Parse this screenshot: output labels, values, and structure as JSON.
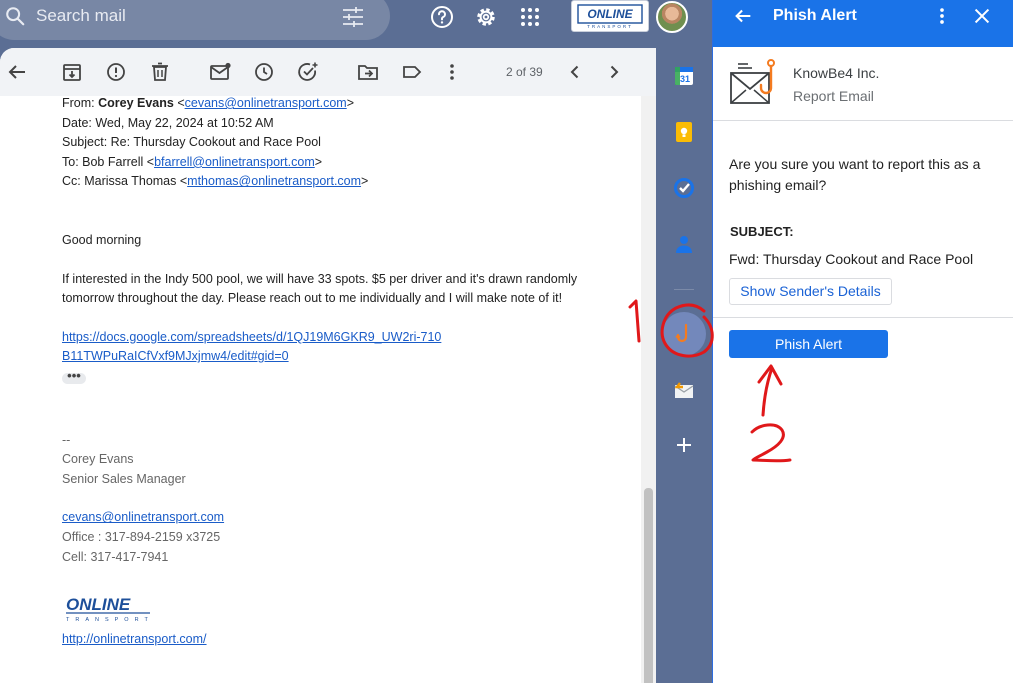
{
  "search": {
    "placeholder": "Search mail"
  },
  "toolbar": {
    "pager_text": "2 of 39"
  },
  "email": {
    "from_prefix": "From: ",
    "from_name": "Corey Evans",
    "from_lt": " <",
    "from_email": "cevans@onlinetransport.com",
    "from_gt": ">",
    "date": "Date: Wed, May 22, 2024 at 10:52 AM",
    "subject": "Subject: Re: Thursday Cookout and Race Pool",
    "to_prefix": "To: Bob Farrell <",
    "to_email": "bfarrell@onlinetransport.com",
    "to_gt": ">",
    "cc_prefix": "Cc: Marissa Thomas <",
    "cc_email": "mthomas@onlinetransport.com",
    "cc_gt": ">",
    "greeting": "Good morning",
    "body": "If interested in the Indy 500 pool, we will have 33 spots. $5 per driver and it's drawn randomly tomorrow throughout the day. Please reach out to me individually and I will make note of it!",
    "link": "https://docs.google.com/spreadsheets/d/1QJ19M6GKR9_UW2ri-710B11TWPuRaICfVxf9MJxjmw4/edit#gid=0",
    "ellipsis": "•••",
    "sig_dashes": "--",
    "sig_name": "Corey Evans",
    "sig_title": "Senior Sales Manager",
    "sig_email": "cevans@onlinetransport.com",
    "sig_office": "Office : 317-894-2159 x3725",
    "sig_cell": "Cell: 317-417-7941",
    "sig_url": "http://onlinetransport.com/"
  },
  "logo": {
    "word": "ONLINE",
    "tagline": "TRANSPORT"
  },
  "phish_panel": {
    "title": "Phish Alert",
    "vendor_name": "KnowBe4 Inc.",
    "vendor_subtitle": "Report Email",
    "question": "Are you sure you want to report this as a phishing email?",
    "subject_label": "SUBJECT:",
    "subject_value": "Fwd: Thursday Cookout and Race Pool",
    "details_button": "Show Sender's Details",
    "submit_button": "Phish Alert"
  },
  "annotations": {
    "step1": "1",
    "step2": "2"
  },
  "icons": {
    "search": "search-icon",
    "tune": "tune-icon",
    "help": "help-icon",
    "settings": "gear-icon",
    "apps": "apps-grid-icon",
    "back": "arrow-back-icon",
    "archive": "archive-icon",
    "spam": "report-spam-icon",
    "delete": "trash-icon",
    "unread": "mark-unread-icon",
    "snooze": "snooze-clock-icon",
    "task": "add-task-icon",
    "move": "move-to-icon",
    "label": "label-icon",
    "more": "more-vert-icon",
    "prev": "chevron-left-icon",
    "next": "chevron-right-icon",
    "calendar": "calendar-icon",
    "keep": "keep-icon",
    "tasks": "tasks-icon",
    "contacts": "contacts-icon",
    "phish": "phish-hook-icon",
    "mail_addon": "mail-addon-icon",
    "add": "plus-icon",
    "close": "close-icon"
  },
  "colors": {
    "header_blue": "#1a73e8",
    "chrome": "#5b6e94",
    "annotation_red": "#e0181a",
    "link": "#1a5cc8"
  }
}
